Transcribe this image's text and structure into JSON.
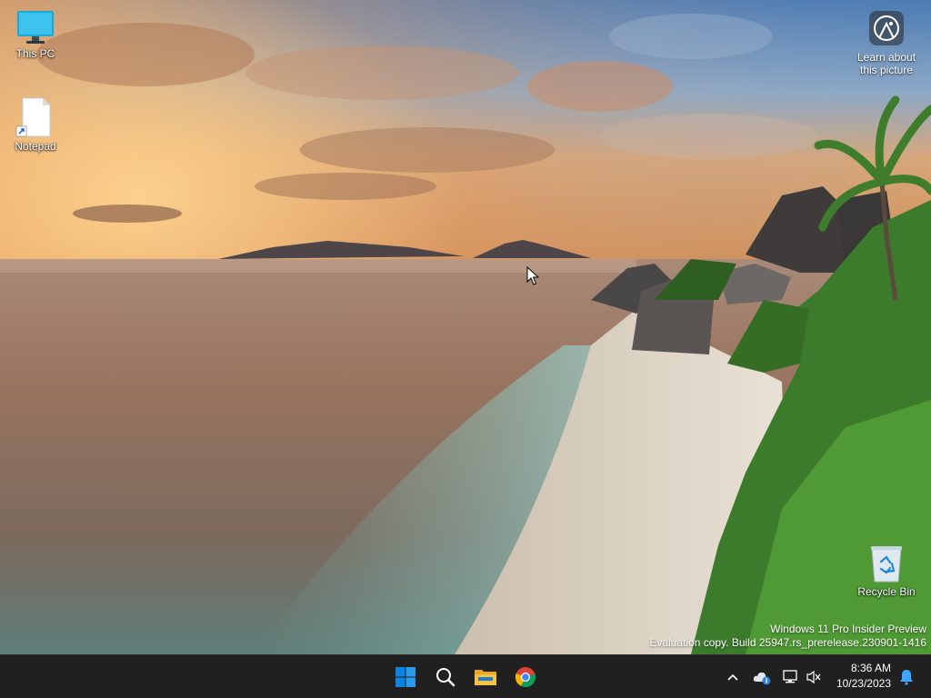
{
  "desktop": {
    "icons": [
      {
        "label": "This PC",
        "icon": "monitor-icon"
      },
      {
        "label": "Notepad",
        "icon": "notepad-shortcut-icon"
      },
      {
        "label": "Recycle Bin",
        "icon": "recycle-bin-icon"
      }
    ],
    "learn_about": {
      "line1": "Learn about",
      "line2": "this picture",
      "icon": "camera-info-icon"
    },
    "watermark": {
      "line1": "Windows 11 Pro Insider Preview",
      "line2": "Evaluation copy. Build 25947.rs_prerelease.230901-1416"
    },
    "wallpaper_icon": "beach-sunset-wallpaper"
  },
  "taskbar": {
    "apps": [
      {
        "icon": "windows-start-icon"
      },
      {
        "icon": "search-icon"
      },
      {
        "icon": "file-explorer-icon"
      },
      {
        "icon": "chrome-icon"
      }
    ],
    "tray": {
      "chevron_icon": "chevron-up-icon",
      "weather_icon": "weather-cloud-icon",
      "network_icon": "network-icon",
      "volume_icon": "volume-muted-icon",
      "notification_icon": "bell-icon"
    },
    "clock": {
      "time": "8:36 AM",
      "date": "10/23/2023"
    }
  },
  "colors": {
    "taskbar_bg": "#202020",
    "start_blue": "#0a84e0",
    "folder_yellow": "#f5c242"
  }
}
